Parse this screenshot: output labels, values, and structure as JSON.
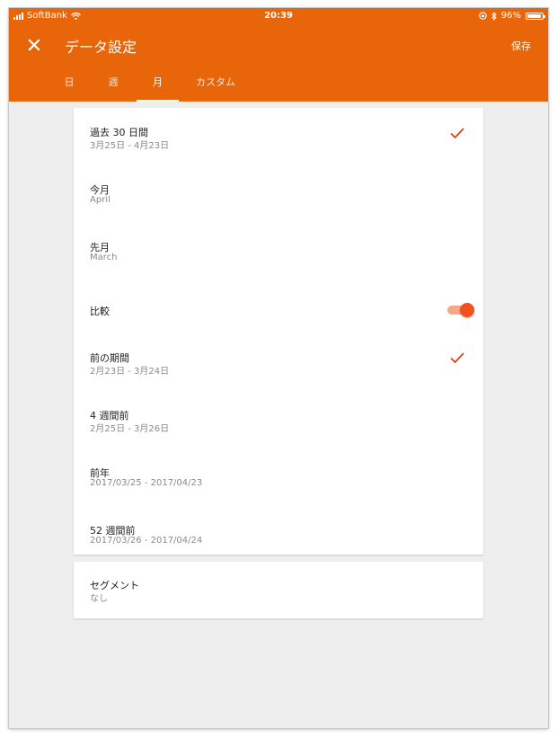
{
  "status_bar": {
    "carrier": "SoftBank",
    "time": "20:39",
    "battery": "96%",
    "battery_level": 0.96
  },
  "header": {
    "title": "データ設定",
    "save_label": "保存",
    "close_icon": "close-icon",
    "background_color": "#e8650a"
  },
  "tabs": [
    {
      "label": "日",
      "active": false
    },
    {
      "label": "週",
      "active": false
    },
    {
      "label": "月",
      "active": true
    },
    {
      "label": "カスタム",
      "active": false
    }
  ],
  "range_options": [
    {
      "title": "過去 30 日間",
      "subtitle": "3月25日 - 4月23日",
      "checked": true
    },
    {
      "title": "今月",
      "subtitle": "April",
      "checked": false
    },
    {
      "title": "先月",
      "subtitle": "March",
      "checked": false
    }
  ],
  "compare": {
    "label": "比較",
    "enabled": true
  },
  "compare_options": [
    {
      "title": "前の期間",
      "subtitle": "2月23日 - 3月24日",
      "checked": true
    },
    {
      "title": "4 週間前",
      "subtitle": "2月25日 - 3月26日",
      "checked": false
    },
    {
      "title": "前年",
      "subtitle": "2017/03/25 - 2017/04/23",
      "checked": false
    },
    {
      "title": "52 週間前",
      "subtitle": "2017/03/26 - 2017/04/24",
      "checked": false
    }
  ],
  "segment": {
    "title": "セグメント",
    "value": "なし"
  },
  "accent_color": "#e8400a"
}
